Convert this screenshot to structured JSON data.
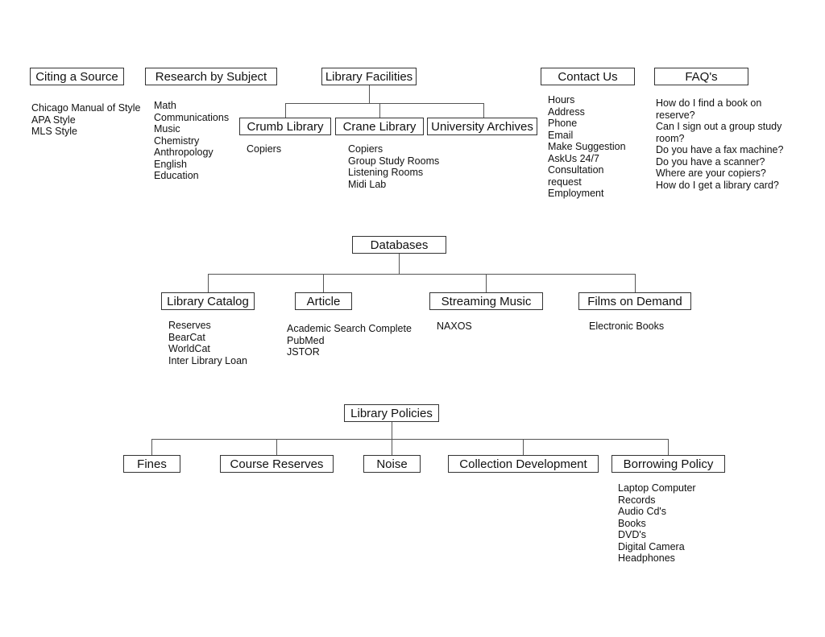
{
  "top": {
    "citing": {
      "label": "Citing a Source",
      "items": [
        "Chicago Manual of Style",
        "APA Style",
        "MLS Style"
      ]
    },
    "research": {
      "label": "Research by Subject",
      "items": [
        "Math",
        "Communications",
        "Music",
        "Chemistry",
        "Anthropology",
        "English",
        "Education"
      ]
    },
    "facilities": {
      "label": "Library Facilities",
      "children": [
        {
          "label": "Crumb Library",
          "items": [
            "Copiers"
          ]
        },
        {
          "label": "Crane Library",
          "items": [
            "Copiers",
            "Group Study Rooms",
            "Listening Rooms",
            "Midi Lab"
          ]
        },
        {
          "label": "University Archives",
          "items": []
        }
      ]
    },
    "contact": {
      "label": "Contact Us",
      "items": [
        "Hours",
        "Address",
        "Phone",
        "Email",
        "Make Suggestion",
        "AskUs 24/7",
        "Consultation",
        "request",
        "Employment"
      ]
    },
    "faq": {
      "label": "FAQ's",
      "items": [
        "How do I find a book on",
        "reserve?",
        "Can I sign out a group study",
        "room?",
        "Do you have a fax machine?",
        "Do you have a scanner?",
        "Where are your copiers?",
        "How do I get a library card?"
      ]
    }
  },
  "databases": {
    "label": "Databases",
    "children": [
      {
        "label": "Library Catalog",
        "items": [
          "Reserves",
          "BearCat",
          "WorldCat",
          "Inter Library Loan"
        ]
      },
      {
        "label": "Article",
        "items": [
          "Academic Search Complete",
          "PubMed",
          "JSTOR"
        ]
      },
      {
        "label": "Streaming Music",
        "items": [
          "NAXOS"
        ]
      },
      {
        "label": "Films on Demand",
        "items": [
          "Electronic Books"
        ]
      }
    ]
  },
  "policies": {
    "label": "Library Policies",
    "children": [
      {
        "label": "Fines",
        "items": []
      },
      {
        "label": "Course Reserves",
        "items": []
      },
      {
        "label": "Noise",
        "items": []
      },
      {
        "label": "Collection Development",
        "items": []
      },
      {
        "label": "Borrowing Policy",
        "items": [
          "Laptop Computer",
          "Records",
          "Audio Cd's",
          "Books",
          "DVD's",
          "Digital Camera",
          "Headphones"
        ]
      }
    ]
  }
}
